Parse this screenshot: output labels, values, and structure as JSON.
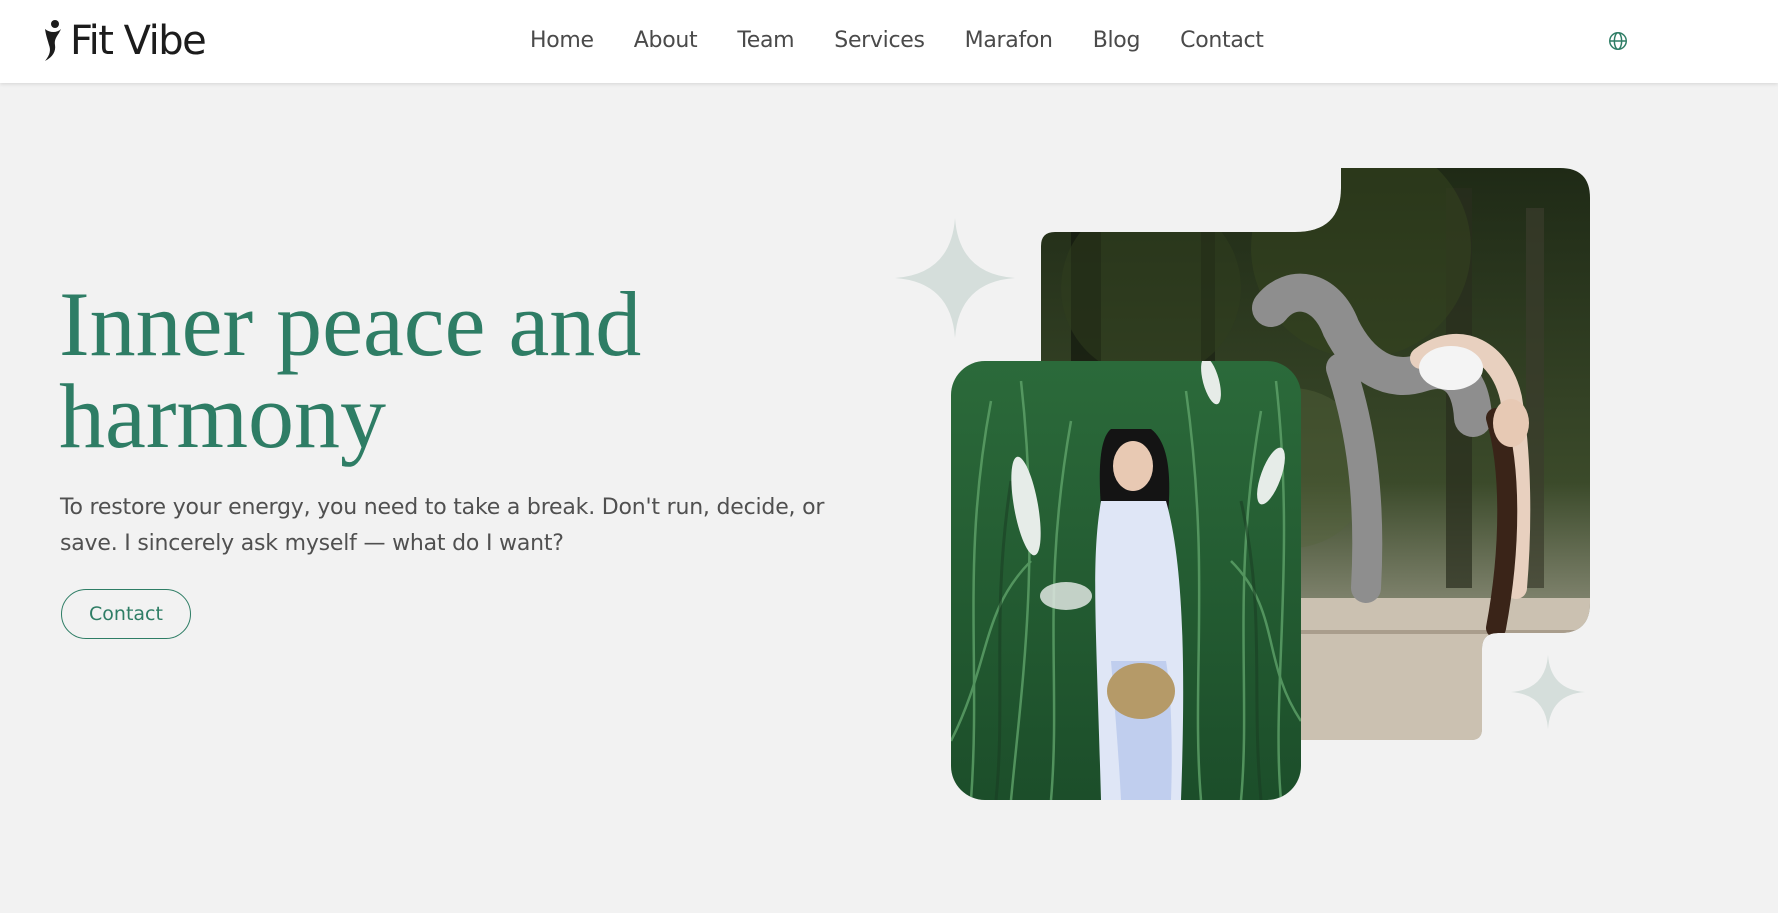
{
  "brand": {
    "name": "Fit Vibe"
  },
  "nav": {
    "items": [
      {
        "label": "Home"
      },
      {
        "label": "About"
      },
      {
        "label": "Team"
      },
      {
        "label": "Services"
      },
      {
        "label": "Marafon"
      },
      {
        "label": "Blog"
      },
      {
        "label": "Contact"
      }
    ],
    "language_icon": "globe-icon"
  },
  "hero": {
    "title_line1": "Inner peace and",
    "title_line2": "harmony",
    "text": "To restore your energy, you need to take a break. Don't run, decide, or save. I sincerely ask myself — what do I want?",
    "cta_label": "Contact"
  },
  "colors": {
    "accent": "#2e7d65",
    "background": "#f2f2f2",
    "navbar": "#ffffff",
    "sparkle": "#d5dedb",
    "text": "#505050"
  },
  "images": {
    "back_photo": "woman in backbend yoga pose in a park",
    "front_photo": "woman in white dress standing in tall green grass"
  }
}
